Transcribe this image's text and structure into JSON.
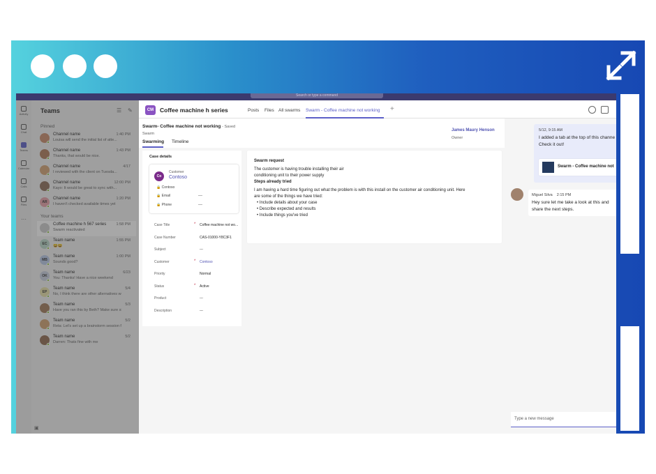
{
  "frame": {
    "accent": "#1f5fbf"
  },
  "app": {
    "search_placeholder": "Search or type a command"
  },
  "rail": [
    {
      "label": "Activity"
    },
    {
      "label": "Chat"
    },
    {
      "label": "Teams"
    },
    {
      "label": "Calendar"
    },
    {
      "label": "Calls"
    },
    {
      "label": "Files"
    }
  ],
  "sidebar": {
    "title": "Teams",
    "pinned_label": "Pinned",
    "your_teams_label": "Your teams",
    "pinned": [
      {
        "name": "Channel  name",
        "preview": "Louisa will send the initial list of atte...",
        "time": "1:40 PM",
        "color": "#c98b6b"
      },
      {
        "name": "Channel  name",
        "preview": "Thanks, that would be nice.",
        "time": "1:43 PM",
        "color": "#b07a5a"
      },
      {
        "name": "Channel  name",
        "preview": "I reviewed with the client on Tuesda...",
        "time": "4/17",
        "color": "#d4a373"
      },
      {
        "name": "Channel  name",
        "preview": "Kayo: It would be great to sync with...",
        "time": "12:00 PM",
        "color": "#8c6d5a"
      },
      {
        "name": "Channel  name",
        "preview": "I haven't checked available times yet",
        "time": "1:20 PM",
        "color": "#e8a0a8",
        "initials": "AR"
      }
    ],
    "teams": [
      {
        "name": "Coffee machine h 567 series",
        "preview": "Swarm reactivated",
        "time": "1:58 PM",
        "color": "#cccccc",
        "active": true
      },
      {
        "name": "Team name",
        "preview": "😀😀",
        "time": "1:55 PM",
        "color": "#b8d8c8",
        "initials": "EC"
      },
      {
        "name": "Team name",
        "preview": "Sounds good?",
        "time": "1:00 PM",
        "color": "#b9c8e8",
        "initials": "MB"
      },
      {
        "name": "Team name",
        "preview": "You: Thanks! Have a nice weekend",
        "time": "6/23",
        "color": "#c8d0e0",
        "initials": "OK"
      },
      {
        "name": "Team name",
        "preview": "No, I think there are other alternatives we c...",
        "time": "5/4",
        "color": "#e8e0a8",
        "initials": "EP"
      },
      {
        "name": "Team name",
        "preview": "Have you ran this by Beth? Make sure she is...",
        "time": "5/3",
        "color": "#a07a5a"
      },
      {
        "name": "Team name",
        "preview": "Reta: Let's set up a brainstorm session for...",
        "time": "5/2",
        "color": "#d0a070"
      },
      {
        "name": "Team name",
        "preview": "Darren: Thats fine with me",
        "time": "5/2",
        "color": "#906a50"
      }
    ]
  },
  "header": {
    "team_initials": "CM",
    "team_name": "Coffee machine h series",
    "tabs": [
      "Posts",
      "Files",
      "All swarms",
      "Swarm - Coffee machine not working"
    ],
    "plus": "+"
  },
  "pane": {
    "title": "Swarm- Coffee machine not working",
    "saved": "- Saved",
    "subtitle": "Swarm",
    "tabs": [
      "Swarming",
      "Timeline"
    ],
    "owner_name": "James Maury Henson",
    "owner_label": "Owner"
  },
  "case": {
    "title": "Case details",
    "customer_label": "Customer",
    "customer_name": "Contoso",
    "customer_initials": "Co",
    "company": "Contoso",
    "email_label": "Email",
    "email_value": "---",
    "phone_label": "Phone",
    "phone_value": "---",
    "fields": [
      {
        "label": "Case Title",
        "value": "Coffee machine not wo...",
        "required": true
      },
      {
        "label": "Case Number",
        "value": "CAS-01000-Y8C3F1",
        "required": false
      },
      {
        "label": "Subject",
        "value": "---",
        "required": false
      },
      {
        "label": "Customer",
        "value": "Contoso",
        "required": true,
        "link": true
      },
      {
        "label": "Priority",
        "value": "Normal",
        "required": false
      },
      {
        "label": "Status",
        "value": "Active",
        "required": true
      },
      {
        "label": "Product",
        "value": "---",
        "required": false
      },
      {
        "label": "Description",
        "value": "---",
        "required": false
      }
    ]
  },
  "request": {
    "title": "Swarm request",
    "line1": "The customer is having trouble installing their air",
    "line2": "conditioning unit to their power supply",
    "tried_title": "Steps already tried",
    "line3": "I am having a hard time figuring out what the problem is with this install on the customer air conditioning unit. Here",
    "line4": "are some of the things we have tried:",
    "bullets": [
      "Include details about your case",
      "Describe expected and results",
      "Include things you've tried"
    ]
  },
  "chat": {
    "my_time": "5/12, 9:15 AM",
    "my_line1": "I added a tab at the top of this channe",
    "my_line2": "Check it out!",
    "card_title": "Swarm - Coffee machine not",
    "other_name": "Miguel Silva",
    "other_time": "2:15 PM",
    "other_line1": "Hey sure let me take a look at this and",
    "other_line2": "share the next steps.",
    "compose_placeholder": "Type a new message"
  }
}
